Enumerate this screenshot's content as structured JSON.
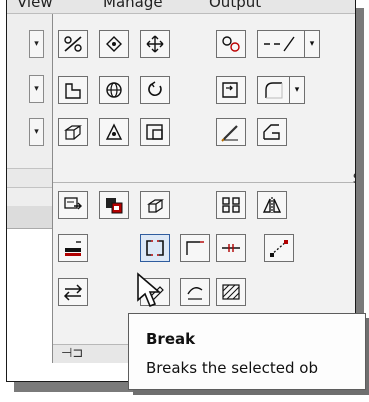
{
  "menubar": {
    "items": [
      "View",
      "Manage",
      "Output"
    ]
  },
  "panel": {
    "side_label": "S"
  },
  "tooltip": {
    "title": "Break",
    "description": "Breaks the selected ob"
  },
  "icons": {
    "row1": [
      "scale-icon",
      "array-icon",
      "move-icon",
      "join-icon",
      "lengthen-icon"
    ],
    "row2": [
      "stretch-icon",
      "rotate3d-icon",
      "rotate-icon",
      "offset-icon",
      "fillet-icon"
    ],
    "row3": [
      "3d-array-icon",
      "align-icon",
      "region-icon",
      "edit-icon",
      "chamfer-icon"
    ],
    "row4": [
      "draworder-icon",
      "match-icon",
      "3d-move-icon",
      "array-rect-icon",
      "mirror-icon"
    ],
    "row5": [
      "bring-front-icon",
      "break-icon",
      "explode-icon",
      "trim-icon",
      "extend-icon"
    ],
    "row6": [
      "swap-icon",
      "pencil-icon",
      "pedit-icon",
      "hatch-edit-icon"
    ]
  }
}
